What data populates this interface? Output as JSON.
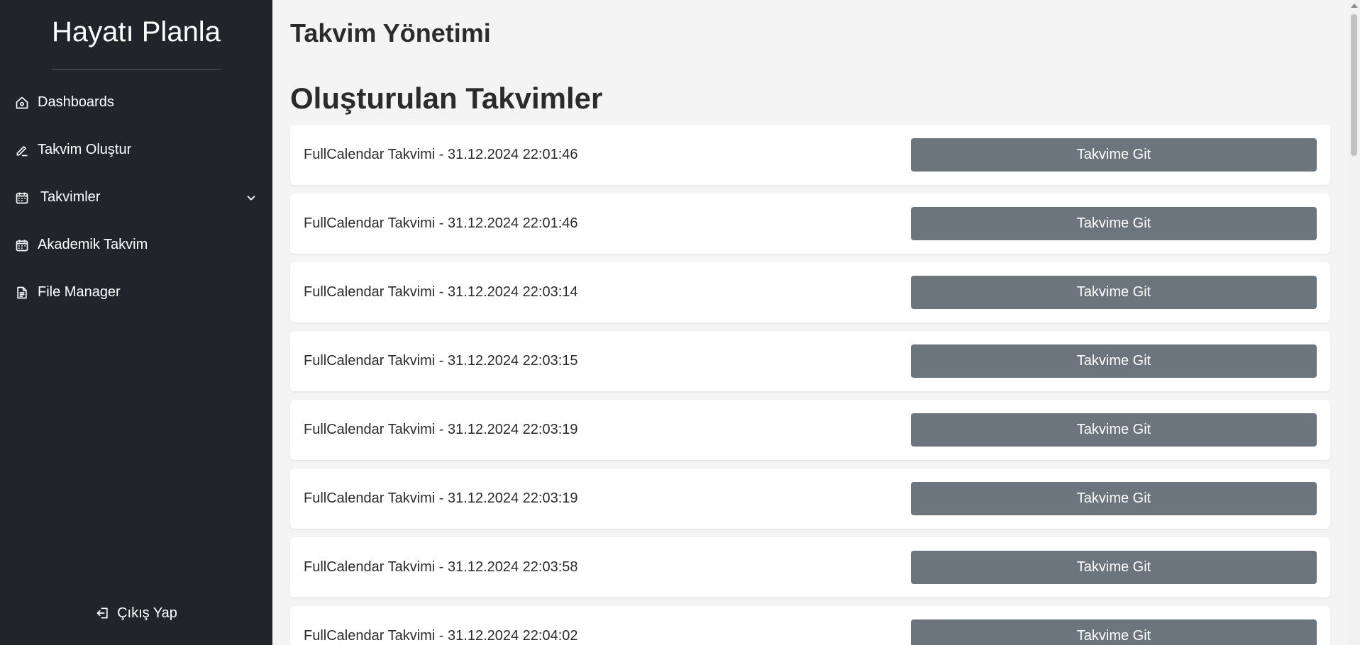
{
  "sidebar": {
    "brand": "Hayatı Planla",
    "items": [
      {
        "label": "Dashboards",
        "icon": "home-icon"
      },
      {
        "label": "Takvim Oluştur",
        "icon": "pencil-icon"
      },
      {
        "label": "Takvimler",
        "icon": "calendar-icon",
        "has_dropdown": true
      },
      {
        "label": "Akademik Takvim",
        "icon": "calendar-icon"
      },
      {
        "label": "File Manager",
        "icon": "file-icon"
      }
    ],
    "logout_label": "Çıkış Yap"
  },
  "main": {
    "page_title": "Takvim Yönetimi",
    "section_title": "Oluşturulan Takvimler",
    "button_label": "Takvime Git",
    "calendars": [
      {
        "title": "FullCalendar Takvimi - 31.12.2024 22:01:46"
      },
      {
        "title": "FullCalendar Takvimi - 31.12.2024 22:01:46"
      },
      {
        "title": "FullCalendar Takvimi - 31.12.2024 22:03:14"
      },
      {
        "title": "FullCalendar Takvimi - 31.12.2024 22:03:15"
      },
      {
        "title": "FullCalendar Takvimi - 31.12.2024 22:03:19"
      },
      {
        "title": "FullCalendar Takvimi - 31.12.2024 22:03:19"
      },
      {
        "title": "FullCalendar Takvimi - 31.12.2024 22:03:58"
      },
      {
        "title": "FullCalendar Takvimi - 31.12.2024 22:04:02"
      }
    ]
  },
  "colors": {
    "sidebar_bg": "#212529",
    "page_bg": "#f4f4f4",
    "button_bg": "#6c757d",
    "card_bg": "#ffffff"
  }
}
